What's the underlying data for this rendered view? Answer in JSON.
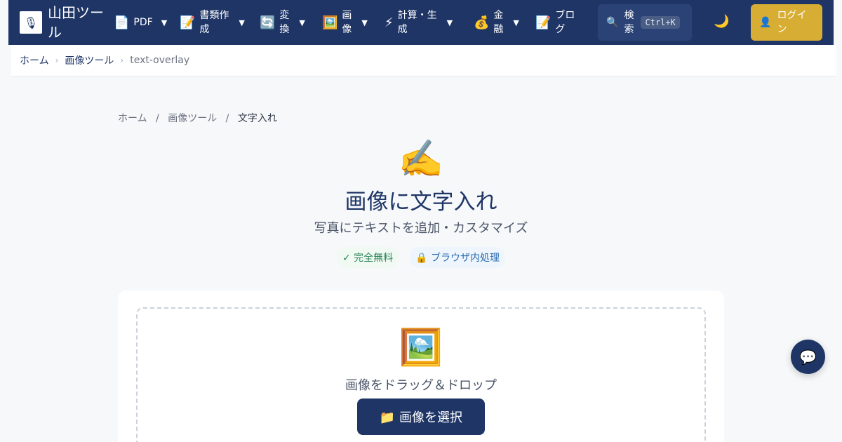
{
  "header": {
    "site_name": "山田ツール",
    "nav": [
      {
        "icon": "📄",
        "label": "PDF"
      },
      {
        "icon": "📝",
        "label": "書類作成"
      },
      {
        "icon": "🔄",
        "label": "変換"
      },
      {
        "icon": "🖼️",
        "label": "画像"
      },
      {
        "icon": "⚡",
        "label": "計算・生成"
      },
      {
        "icon": "💰",
        "label": "金融"
      },
      {
        "icon": "📝",
        "label": "ブログ"
      }
    ],
    "caret": "▼",
    "search_icon": "🔍",
    "search_label": "検索",
    "search_shortcut": "Ctrl+K",
    "theme_icon": "🌙",
    "login_icon": "👤",
    "login_label": "ログイン"
  },
  "breadcrumb": {
    "home": "ホーム",
    "category": "画像ツール",
    "current": "text-overlay",
    "separator": "›"
  },
  "page_breadcrumb": {
    "home": "ホーム",
    "category": "画像ツール",
    "current": "文字入れ",
    "separator": "/"
  },
  "hero": {
    "icon": "✍️",
    "title": "画像に文字入れ",
    "subtitle": "写真にテキストを追加・カスタマイズ",
    "badges": [
      "✓ 完全無料",
      "🔒 ブラウザ内処理"
    ]
  },
  "dropzone": {
    "icon": "🖼️",
    "text": "画像をドラッグ＆ドロップ",
    "button_label": "📁 画像を選択"
  },
  "chat": {
    "icon": "💬"
  }
}
